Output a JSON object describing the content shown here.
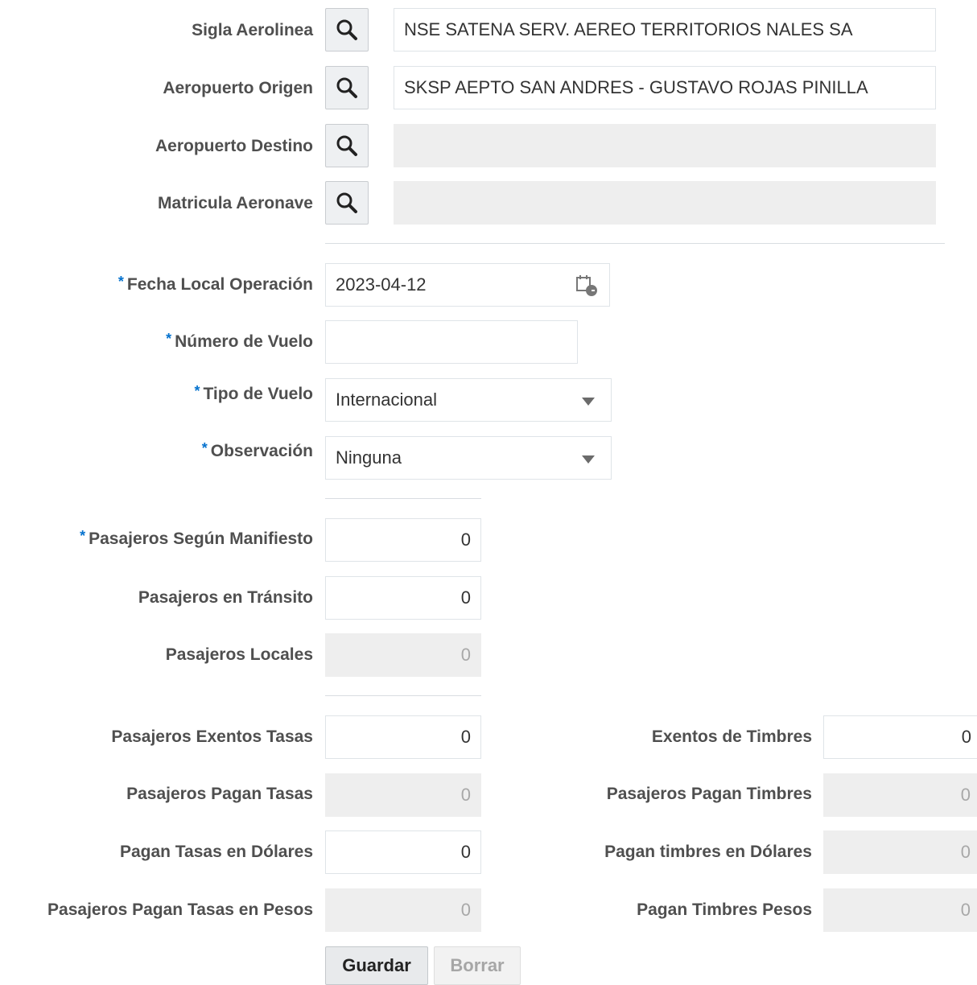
{
  "form": {
    "sigla_aerolinea": {
      "label": "Sigla Aerolinea",
      "value": "NSE SATENA SERV. AEREO TERRITORIOS NALES SA"
    },
    "aeropuerto_origen": {
      "label": "Aeropuerto Origen",
      "value": "SKSP AEPTO SAN ANDRES - GUSTAVO ROJAS PINILLA"
    },
    "aeropuerto_destino": {
      "label": "Aeropuerto Destino",
      "value": ""
    },
    "matricula_aeronave": {
      "label": "Matricula Aeronave",
      "value": ""
    },
    "required_marker": "*",
    "fecha_local_operacion": {
      "label": "Fecha Local Operación",
      "value": "2023-04-12"
    },
    "numero_vuelo": {
      "label": "Número de Vuelo",
      "value": ""
    },
    "tipo_vuelo": {
      "label": "Tipo de Vuelo",
      "value": "Internacional"
    },
    "observacion": {
      "label": "Observación",
      "value": "Ninguna"
    },
    "pasajeros_manifiesto": {
      "label": "Pasajeros Según Manifiesto",
      "value": "0"
    },
    "pasajeros_transito": {
      "label": "Pasajeros en Tránsito",
      "value": "0"
    },
    "pasajeros_locales": {
      "label": "Pasajeros Locales",
      "value": "0"
    },
    "pasajeros_exentos_tasas": {
      "label": "Pasajeros Exentos Tasas",
      "value": "0"
    },
    "pasajeros_pagan_tasas": {
      "label": "Pasajeros Pagan Tasas",
      "value": "0"
    },
    "pagan_tasas_dolares": {
      "label": "Pagan Tasas en Dólares",
      "value": "0"
    },
    "pasajeros_pagan_tasas_pesos": {
      "label": "Pasajeros Pagan Tasas en Pesos",
      "value": "0"
    },
    "exentos_timbres": {
      "label": "Exentos de Timbres",
      "value": "0"
    },
    "pasajeros_pagan_timbres": {
      "label": "Pasajeros Pagan Timbres",
      "value": "0"
    },
    "pagan_timbres_dolares": {
      "label": "Pagan timbres en Dólares",
      "value": "0"
    },
    "pagan_timbres_pesos": {
      "label": "Pagan Timbres Pesos",
      "value": "0"
    }
  },
  "buttons": {
    "guardar": "Guardar",
    "borrar": "Borrar"
  },
  "icons": {
    "lov": "search-icon",
    "calendar": "calendar-clock-icon",
    "dropdown": "chevron-down-icon"
  }
}
